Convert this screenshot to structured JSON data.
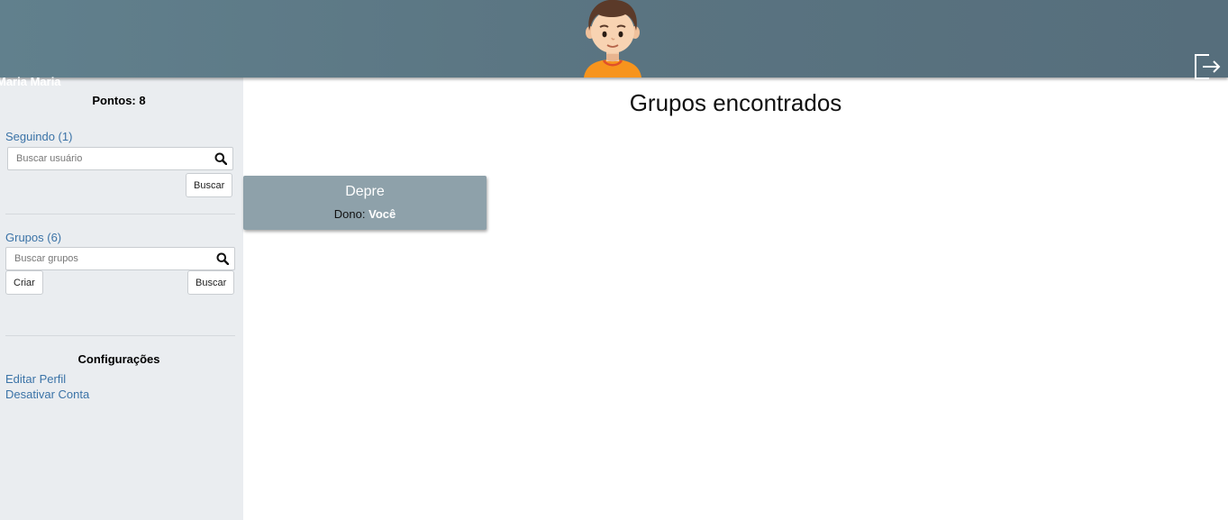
{
  "header": {
    "username": "Maria Maria",
    "avatar_icon": "user-avatar-icon",
    "logout_icon": "logout-icon",
    "colors": {
      "bar": "#5a7481",
      "text": "#ffffff"
    }
  },
  "sidebar": {
    "points": "Pontos: 8",
    "following": {
      "label": "Seguindo (1)",
      "placeholder": "Buscar usuário",
      "value": "",
      "search_button": "Buscar",
      "icon": "search-icon"
    },
    "groups": {
      "label": "Grupos (6)",
      "placeholder": "Buscar grupos",
      "value": "",
      "create_button": "Criar",
      "search_button": "Buscar",
      "icon": "search-icon"
    },
    "settings": {
      "title": "Configurações",
      "links": [
        "Editar Perfil",
        "Desativar Conta"
      ]
    },
    "colors": {
      "background": "#eaedf0",
      "link": "#3b73a7"
    }
  },
  "main": {
    "title": "Grupos encontrados",
    "groups": [
      {
        "name": "Depre",
        "owner_label": "Dono:",
        "owner": "Você"
      }
    ],
    "colors": {
      "card": "#8ea1aa"
    }
  }
}
